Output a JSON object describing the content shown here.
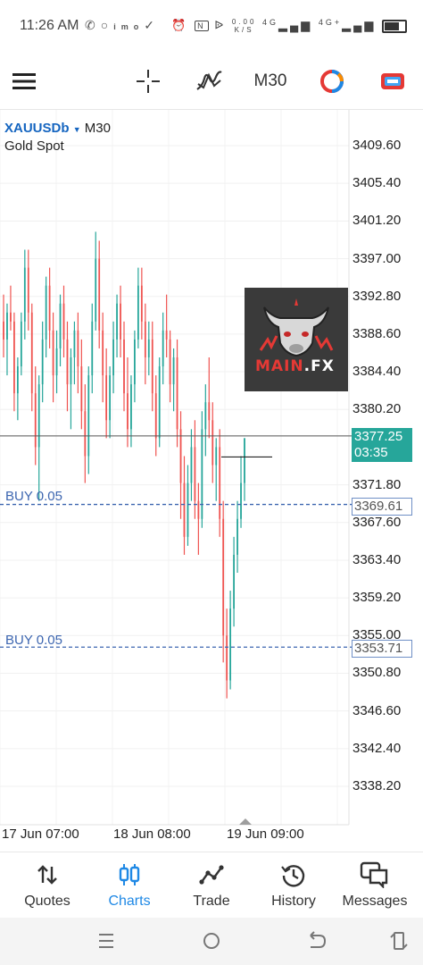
{
  "status_bar": {
    "time": "11:26 AM",
    "speed_value": "0.00",
    "speed_unit": "K/S",
    "network_1": "4G",
    "network_2": "4G+",
    "icons": [
      "whatsapp-icon",
      "circle-icon",
      "imo-icon",
      "check-circle-icon",
      "alarm-icon",
      "nfc-icon",
      "bluetooth-icon",
      "signal-icon",
      "battery-icon"
    ]
  },
  "toolbar": {
    "timeframe": "M30",
    "icons": [
      "menu-icon",
      "crosshair-icon",
      "indicators-icon",
      "color-scheme-icon",
      "trade-icon"
    ]
  },
  "chart": {
    "symbol": "XAUUSDb",
    "timeframe": "M30",
    "description": "Gold Spot",
    "current_price": "3377.25",
    "countdown": "03:35",
    "price_labels": [
      "3409.60",
      "3405.40",
      "3401.20",
      "3397.00",
      "3392.80",
      "3388.60",
      "3384.40",
      "3380.20",
      "3371.80",
      "3367.60",
      "3363.40",
      "3359.20",
      "3355.00",
      "3350.80",
      "3346.60",
      "3342.40",
      "3338.20"
    ],
    "orders": [
      {
        "label": "BUY 0.05",
        "price": "3369.61"
      },
      {
        "label": "BUY 0.05",
        "price": "3353.71"
      }
    ],
    "time_labels": [
      "17 Jun 07:00",
      "18 Jun 08:00",
      "19 Jun 09:00"
    ],
    "logo_text_1": "MAIN",
    "logo_text_2": ".FX",
    "bull_color": "#26a69a",
    "bear_color": "#ef5350"
  },
  "chart_data": {
    "type": "candlestick",
    "title": "",
    "ylim": [
      3336.0,
      3412.0
    ],
    "y_ticks": [
      3409.6,
      3405.4,
      3401.2,
      3397.0,
      3392.8,
      3388.6,
      3384.4,
      3380.2,
      3371.8,
      3367.6,
      3363.4,
      3359.2,
      3355.0,
      3350.8,
      3346.6,
      3342.4,
      3338.2
    ],
    "x_ticks": [
      "17 Jun 07:00",
      "18 Jun 08:00",
      "19 Jun 09:00"
    ],
    "current_price": 3377.25,
    "horizontal_lines": [
      3377.25,
      3369.61,
      3353.71
    ],
    "series": [
      {
        "values": [
          [
            3390,
            3393,
            3386,
            3388
          ],
          [
            3388,
            3392,
            3384,
            3391
          ],
          [
            3391,
            3394,
            3389,
            3390
          ],
          [
            3390,
            3391,
            3380,
            3382
          ],
          [
            3382,
            3386,
            3379,
            3385
          ],
          [
            3385,
            3391,
            3384,
            3390
          ],
          [
            3390,
            3398,
            3388,
            3396
          ],
          [
            3396,
            3398,
            3389,
            3391
          ],
          [
            3391,
            3392,
            3380,
            3382
          ],
          [
            3382,
            3385,
            3374,
            3376
          ],
          [
            3376,
            3384,
            3370,
            3383
          ],
          [
            3383,
            3390,
            3381,
            3388
          ],
          [
            3388,
            3395,
            3386,
            3394
          ],
          [
            3394,
            3396,
            3387,
            3389
          ],
          [
            3389,
            3391,
            3381,
            3384
          ],
          [
            3384,
            3389,
            3382,
            3387
          ],
          [
            3387,
            3393,
            3385,
            3392
          ],
          [
            3392,
            3394,
            3386,
            3388
          ],
          [
            3388,
            3390,
            3380,
            3383
          ],
          [
            3383,
            3387,
            3378,
            3386
          ],
          [
            3386,
            3390,
            3383,
            3389
          ],
          [
            3389,
            3391,
            3382,
            3385
          ],
          [
            3385,
            3388,
            3378,
            3380
          ],
          [
            3380,
            3383,
            3372,
            3375
          ],
          [
            3375,
            3385,
            3373,
            3384
          ],
          [
            3384,
            3392,
            3382,
            3390
          ],
          [
            3390,
            3400,
            3389,
            3397
          ],
          [
            3397,
            3399,
            3387,
            3389
          ],
          [
            3389,
            3391,
            3381,
            3384
          ],
          [
            3384,
            3387,
            3377,
            3379
          ],
          [
            3379,
            3385,
            3377,
            3384
          ],
          [
            3384,
            3390,
            3382,
            3388
          ],
          [
            3388,
            3393,
            3386,
            3392
          ],
          [
            3392,
            3394,
            3386,
            3388
          ],
          [
            3388,
            3390,
            3380,
            3382
          ],
          [
            3382,
            3386,
            3376,
            3378
          ],
          [
            3378,
            3384,
            3376,
            3383
          ],
          [
            3383,
            3389,
            3381,
            3388
          ],
          [
            3388,
            3396,
            3387,
            3394
          ],
          [
            3394,
            3396,
            3388,
            3390
          ],
          [
            3390,
            3392,
            3383,
            3386
          ],
          [
            3386,
            3390,
            3384,
            3388
          ],
          [
            3388,
            3390,
            3380,
            3382
          ],
          [
            3382,
            3384,
            3375,
            3377
          ],
          [
            3377,
            3386,
            3376,
            3385
          ],
          [
            3385,
            3391,
            3383,
            3389
          ],
          [
            3389,
            3393,
            3386,
            3388
          ],
          [
            3388,
            3389,
            3381,
            3383
          ],
          [
            3383,
            3387,
            3380,
            3386
          ],
          [
            3386,
            3388,
            3376,
            3378
          ],
          [
            3378,
            3380,
            3368,
            3372
          ],
          [
            3372,
            3375,
            3364,
            3366
          ],
          [
            3366,
            3374,
            3365,
            3372
          ],
          [
            3372,
            3378,
            3370,
            3376
          ],
          [
            3376,
            3379,
            3368,
            3370
          ],
          [
            3370,
            3372,
            3364,
            3368
          ],
          [
            3368,
            3380,
            3367,
            3378
          ],
          [
            3378,
            3383,
            3375,
            3381
          ],
          [
            3381,
            3386,
            3377,
            3379
          ],
          [
            3379,
            3381,
            3372,
            3374
          ],
          [
            3374,
            3377,
            3370,
            3376
          ],
          [
            3376,
            3378,
            3366,
            3368
          ],
          [
            3368,
            3370,
            3352,
            3355
          ],
          [
            3355,
            3358,
            3348,
            3350
          ],
          [
            3350,
            3360,
            3349,
            3358
          ],
          [
            3358,
            3366,
            3356,
            3364
          ],
          [
            3364,
            3370,
            3362,
            3368
          ],
          [
            3368,
            3375,
            3367,
            3372
          ],
          [
            3372,
            3377,
            3370,
            3377
          ]
        ]
      }
    ]
  },
  "nav": {
    "items": [
      {
        "label": "Quotes",
        "icon": "quotes-icon"
      },
      {
        "label": "Charts",
        "icon": "charts-icon"
      },
      {
        "label": "Trade",
        "icon": "trade-icon"
      },
      {
        "label": "History",
        "icon": "history-icon"
      },
      {
        "label": "Messages",
        "icon": "messages-icon"
      }
    ],
    "active": "Charts"
  }
}
